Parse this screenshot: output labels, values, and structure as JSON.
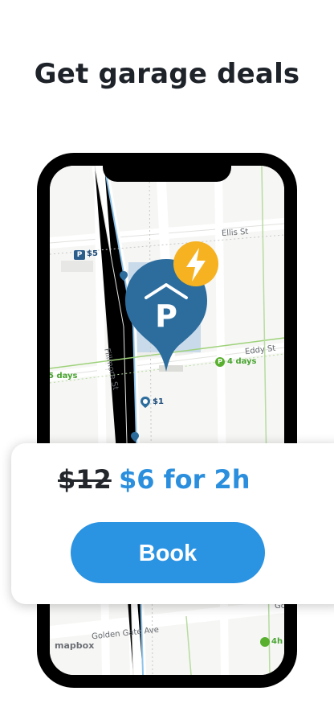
{
  "headline": "Get garage deals",
  "map": {
    "streets": {
      "ellis": "Ellis St",
      "eddy": "Eddy St",
      "fillmore": "Fillmore St",
      "golden_gate": "Golden Gate Ave",
      "right_edge": "Go"
    },
    "lots": {
      "price_left": "$5",
      "price_lower": "$1",
      "pin_partial": "$"
    },
    "day_labels": {
      "left": "5 days",
      "right": "4 days",
      "bottom": "4h"
    },
    "attribution": "mapbox",
    "colors": {
      "pin": "#2c6d9e",
      "bolt_badge": "#f6b220",
      "river": "#8ec4ea",
      "green_path": "#9ed27a"
    },
    "icons": [
      "parking-pin-icon",
      "lightning-bolt-icon",
      "parking-lot-icon",
      "clock-icon"
    ]
  },
  "card": {
    "old_price": "$12",
    "new_price": "$6 for 2h",
    "book_label": "Book",
    "accent": "#2a93e2"
  }
}
